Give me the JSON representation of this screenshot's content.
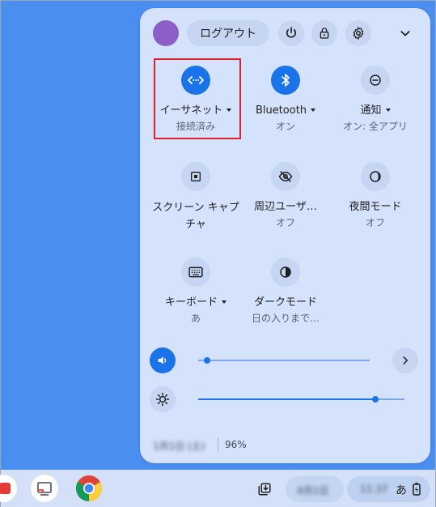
{
  "header": {
    "logout_label": "ログアウト",
    "icons": [
      "power-icon",
      "lock-icon",
      "settings-icon",
      "chevron-down-icon"
    ]
  },
  "tiles": [
    {
      "label": "イーサネット",
      "sub": "接続済み",
      "icon": "ethernet-icon",
      "active": true,
      "has_menu": true
    },
    {
      "label": "Bluetooth",
      "sub": "オン",
      "icon": "bluetooth-icon",
      "active": true,
      "has_menu": true
    },
    {
      "label": "通知",
      "sub": "オン: 全アプリ",
      "icon": "notification-icon",
      "active": false,
      "has_menu": true
    },
    {
      "label": "スクリーン キャプチャ",
      "sub": "",
      "icon": "screen-capture-icon",
      "active": false,
      "has_menu": false
    },
    {
      "label": "周辺ユーザ…",
      "sub": "オフ",
      "icon": "hidden-eye-icon",
      "active": false,
      "has_menu": false
    },
    {
      "label": "夜間モード",
      "sub": "オフ",
      "icon": "night-mode-icon",
      "active": false,
      "has_menu": false
    },
    {
      "label": "キーボード",
      "sub": "あ",
      "icon": "keyboard-icon",
      "active": false,
      "has_menu": true
    },
    {
      "label": "ダークモード",
      "sub": "日の入りまで…",
      "icon": "dark-mode-icon",
      "active": false,
      "has_menu": false
    }
  ],
  "sliders": {
    "volume_level": 0.05,
    "brightness_level": 0.86
  },
  "footer": {
    "date_blurred": "1月1日 (土)",
    "battery": "96%"
  },
  "shelf": {
    "date_blurred": "4月1日",
    "time_blurred": "11:37",
    "ime": "あ"
  },
  "colors": {
    "desktop": "#4a8ef0",
    "panel": "#d4e2fb",
    "accent": "#1a73e8",
    "highlight": "#e0202a"
  }
}
